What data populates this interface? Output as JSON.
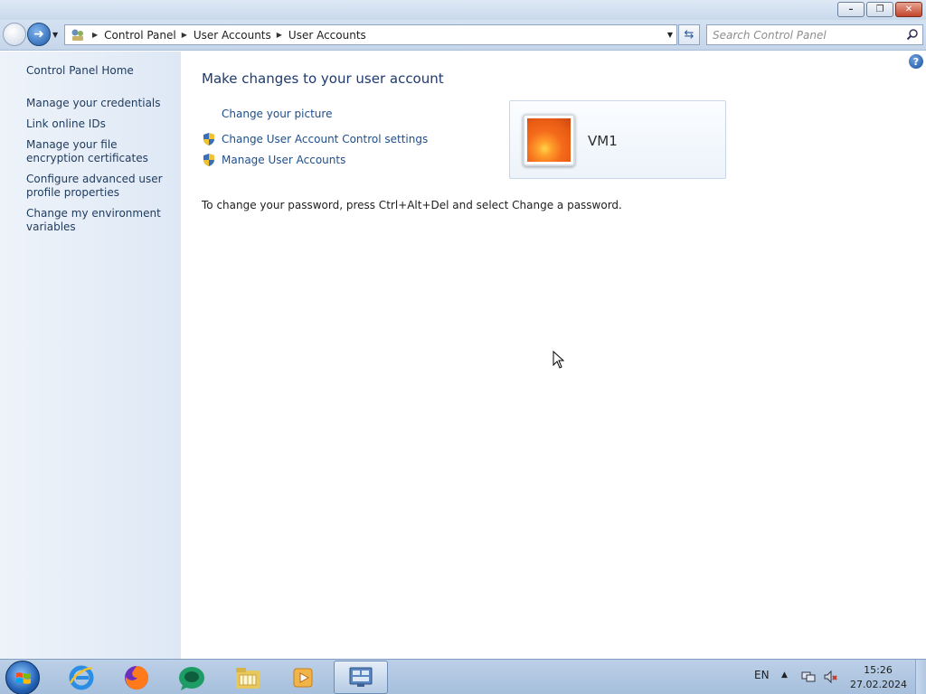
{
  "window": {
    "buttons": {
      "minimize": "–",
      "restore": "❐",
      "close": "✕"
    }
  },
  "address_bar": {
    "crumbs": [
      "Control Panel",
      "User Accounts",
      "User Accounts"
    ]
  },
  "search": {
    "placeholder": "Search Control Panel"
  },
  "sidebar": {
    "home": "Control Panel Home",
    "links": [
      "Manage your credentials",
      "Link online IDs",
      "Manage your file encryption certificates",
      "Configure advanced user profile properties",
      "Change my environment variables"
    ]
  },
  "main": {
    "heading": "Make changes to your user account",
    "tasks": {
      "change_picture": "Change your picture",
      "uac_settings": "Change User Account Control settings",
      "manage_accounts": "Manage User Accounts"
    },
    "account_name": "VM1",
    "password_note": "To change your password, press Ctrl+Alt+Del and select Change a password.",
    "help": "?"
  },
  "taskbar": {
    "apps": [
      "internet-explorer",
      "firefox",
      "app-green",
      "windows-explorer",
      "media-player",
      "control-panel"
    ],
    "language": "EN",
    "time": "15:26",
    "date": "27.02.2024"
  },
  "colors": {
    "link": "#1e4e8c",
    "heading": "#1e3a6e",
    "sidebar": "#e5edf7",
    "taskbar": "#b3c8e1"
  }
}
